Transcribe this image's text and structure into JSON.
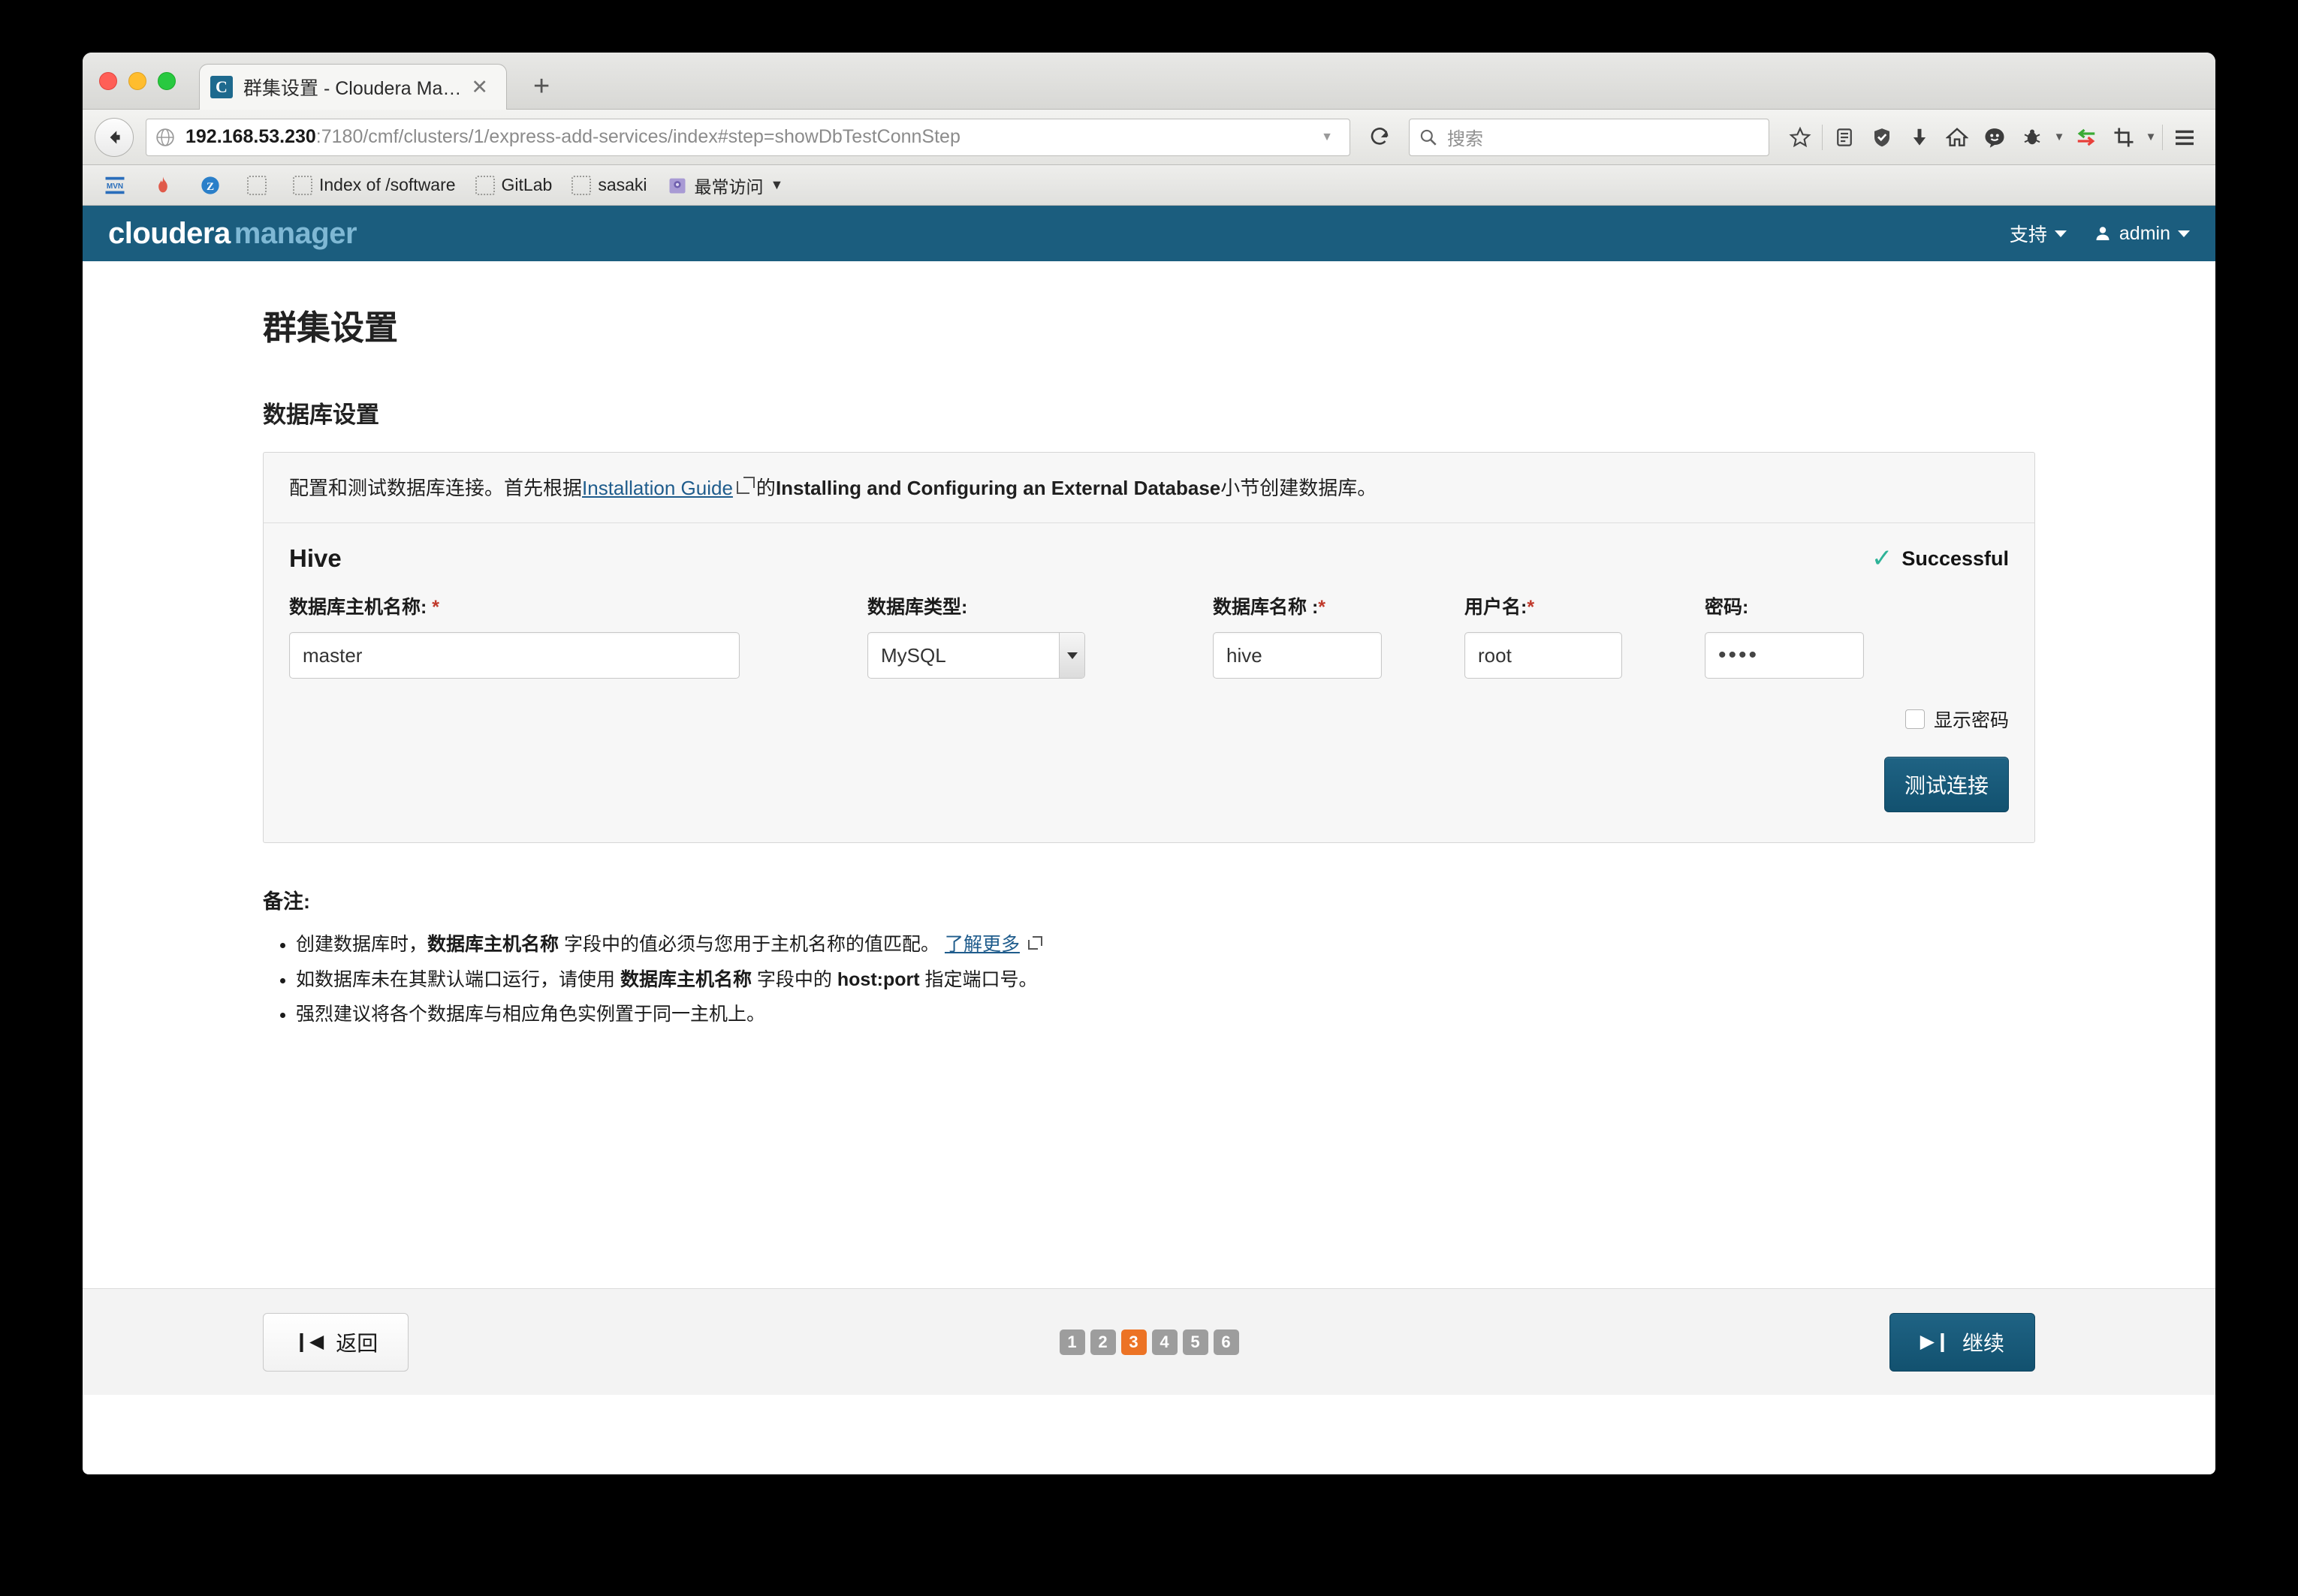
{
  "browser": {
    "tab": {
      "title": "群集设置 - Cloudera Manager",
      "favicon_letter": "C",
      "close_label": "✕"
    },
    "new_tab_label": "+",
    "url": {
      "host": "192.168.53.230",
      "path": ":7180/cmf/clusters/1/express-add-services/index#step=showDbTestConnStep"
    },
    "search_placeholder": "搜索",
    "bookmarks": [
      {
        "label": "",
        "icon": "mvn-icon"
      },
      {
        "label": "",
        "icon": "flame-icon"
      },
      {
        "label": "",
        "icon": "zotero-icon"
      },
      {
        "label": "",
        "icon": "placeholder-icon"
      },
      {
        "label": "Index of /software",
        "icon": "placeholder-icon"
      },
      {
        "label": "GitLab",
        "icon": "placeholder-icon"
      },
      {
        "label": "sasaki",
        "icon": "placeholder-icon"
      },
      {
        "label": "最常访问",
        "icon": "folder-icon"
      }
    ],
    "toolbar_icons": [
      "star-icon",
      "reader-icon",
      "shield-icon",
      "download-icon",
      "home-icon",
      "smiley-icon",
      "bug-icon",
      "sync-icon",
      "screenshot-icon",
      "menu-icon"
    ]
  },
  "app_header": {
    "logo_primary": "cloudera",
    "logo_secondary": "manager",
    "support_label": "支持",
    "user_label": "admin"
  },
  "page": {
    "title": "群集设置",
    "section_title": "数据库设置",
    "description": {
      "before_link": "配置和测试数据库连接。首先根据",
      "link_text": "Installation Guide",
      "after_link": "的",
      "bold_text": "Installing and Configuring an External Database",
      "tail": "小节创建数据库。"
    },
    "service": {
      "name": "Hive",
      "status_text": "Successful",
      "status_check": "✓",
      "status_color": "#2eb398"
    },
    "fields": [
      {
        "label": "数据库主机名称:",
        "required": true,
        "value": "master",
        "type": "text",
        "name": "db-hostname"
      },
      {
        "label": "数据库类型:",
        "required": false,
        "value": "MySQL",
        "type": "select",
        "name": "db-type"
      },
      {
        "label": "数据库名称 :",
        "required": true,
        "value": "hive",
        "type": "text",
        "name": "db-name"
      },
      {
        "label": "用户名:",
        "required": true,
        "value": "root",
        "type": "text",
        "name": "db-username"
      },
      {
        "label": "密码:",
        "required": false,
        "value": "••••",
        "type": "password",
        "name": "db-password"
      }
    ],
    "show_password_label": "显示密码",
    "show_password_checked": false,
    "test_connection_label": "测试连接",
    "notes_title": "备注:",
    "notes": [
      {
        "parts": [
          {
            "t": "创建数据库时，",
            "style": "normal"
          },
          {
            "t": "数据库主机名称",
            "style": "bold"
          },
          {
            "t": " 字段中的值必须与您用于主机名称的值匹配。 ",
            "style": "normal"
          },
          {
            "t": "了解更多",
            "style": "link"
          }
        ]
      },
      {
        "parts": [
          {
            "t": "如数据库未在其默认端口运行，请使用 ",
            "style": "normal"
          },
          {
            "t": "数据库主机名称",
            "style": "bold"
          },
          {
            "t": " 字段中的 ",
            "style": "normal"
          },
          {
            "t": "host:port",
            "style": "bold"
          },
          {
            "t": " 指定端口号。",
            "style": "normal"
          }
        ]
      },
      {
        "parts": [
          {
            "t": "强烈建议将各个数据库与相应角色实例置于同一主机上。",
            "style": "normal"
          }
        ]
      }
    ]
  },
  "footer": {
    "back_label": "返回",
    "back_icon": "❙◀",
    "continue_label": "继续",
    "continue_icon": "▶❙",
    "pages": [
      "1",
      "2",
      "3",
      "4",
      "5",
      "6"
    ],
    "active_page": "3",
    "active_color": "#ec7325"
  }
}
